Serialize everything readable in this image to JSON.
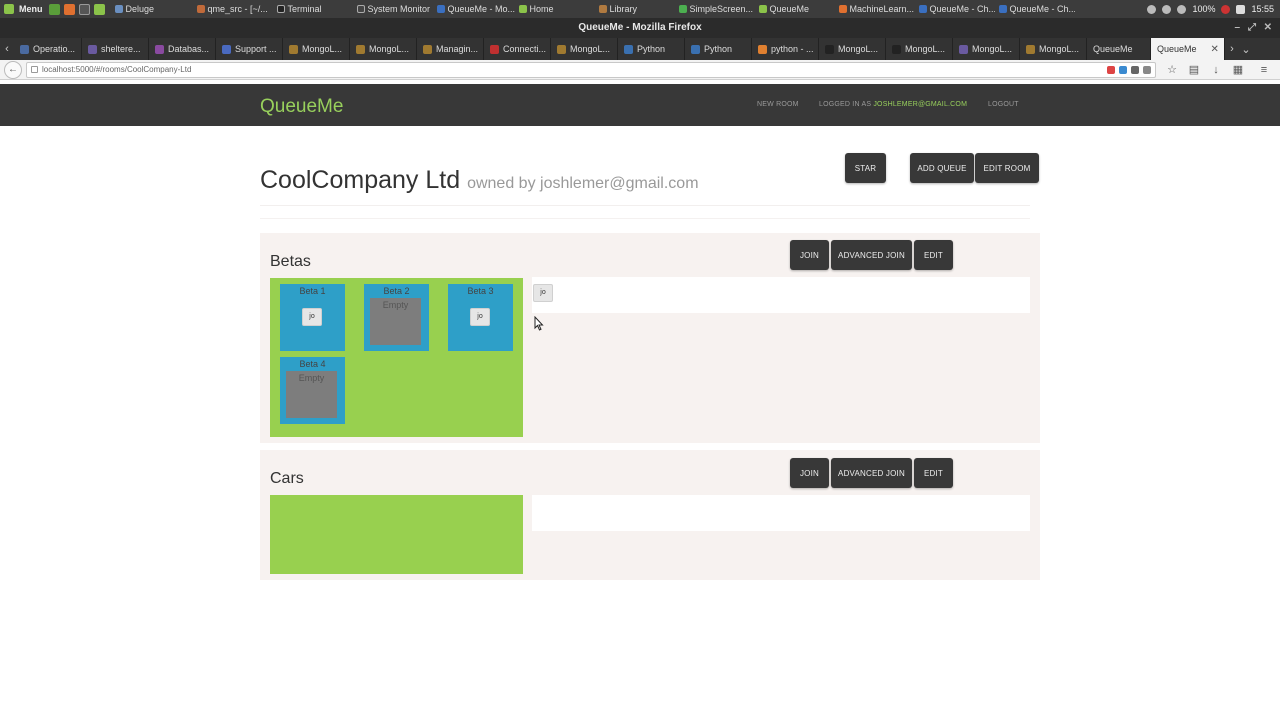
{
  "taskbar": {
    "menu_label": "Menu",
    "tasks": [
      "Deluge",
      "qme_src - [~/...",
      "Terminal",
      "System Monitor",
      "QueueMe - Mo...",
      "Home",
      "Library",
      "SimpleScreen...",
      "QueueMe",
      "MachineLearn...",
      "QueueMe - Ch...",
      "QueueMe - Ch..."
    ],
    "battery": "100%",
    "clock": "15:55"
  },
  "browser": {
    "window_title": "QueueMe - Mozilla Firefox",
    "tabs": [
      "Operatio...",
      "sheltere...",
      "Databas...",
      "Support ...",
      "MongoL...",
      "MongoL...",
      "Managin...",
      "Connecti...",
      "MongoL...",
      "Python",
      "Python",
      "python - ...",
      "MongoL...",
      "MongoL...",
      "MongoL...",
      "MongoL...",
      "QueueMe",
      "QueueMe"
    ],
    "active_tab": "QueueMe",
    "url": "localhost:5000/#/rooms/CoolCompany-Ltd"
  },
  "header": {
    "brand": "QueueMe",
    "new_room": "NEW ROOM",
    "logged_in_prefix": "LOGGED IN AS",
    "user_email": "JOSHLEMER@GMAIL.COM",
    "logout": "LOGOUT"
  },
  "room": {
    "name": "CoolCompany Ltd",
    "owner": "owned by joshlemer@gmail.com",
    "buttons": {
      "star": "STAR",
      "add_queue": "ADD QUEUE",
      "edit_room": "EDIT ROOM"
    }
  },
  "queues": [
    {
      "name": "Betas",
      "buttons": {
        "join": "JOIN",
        "advanced_join": "ADVANCED JOIN",
        "edit": "EDIT"
      },
      "slots": [
        {
          "name": "Beta 1",
          "occupant": "jo",
          "empty_label": ""
        },
        {
          "name": "Beta 2",
          "occupant": "",
          "empty_label": "Empty"
        },
        {
          "name": "Beta 3",
          "occupant": "jo",
          "empty_label": ""
        },
        {
          "name": "Beta 4",
          "occupant": "",
          "empty_label": "Empty"
        }
      ],
      "waiting": [
        "jo"
      ]
    },
    {
      "name": "Cars",
      "buttons": {
        "join": "JOIN",
        "advanced_join": "ADVANCED JOIN",
        "edit": "EDIT"
      },
      "slots": [],
      "waiting": []
    }
  ],
  "colors": {
    "header_bg": "#383838",
    "brand_green": "#98d05c",
    "slot_area_green": "#98d04f",
    "slot_blue": "#2e9fc8",
    "slot_empty_gray": "#7d7d7d",
    "queue_bg": "#f7f2f0"
  }
}
